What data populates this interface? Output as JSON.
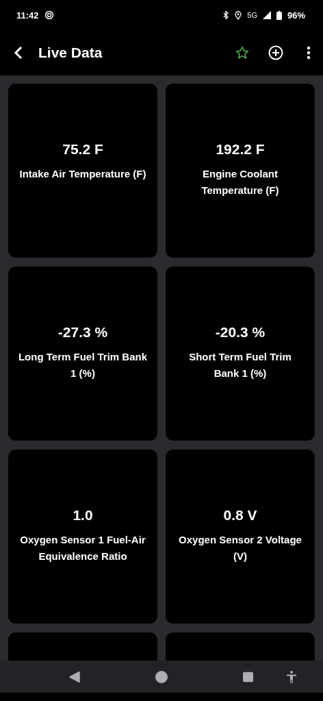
{
  "status_bar": {
    "time": "11:42",
    "network": "5G",
    "battery": "96%"
  },
  "app_bar": {
    "title": "Live Data"
  },
  "tiles": [
    {
      "kind": "reading",
      "value": "75.2 F",
      "label": "Intake Air Temperature (F)"
    },
    {
      "kind": "reading",
      "value": "192.2 F",
      "label": "Engine Coolant Temperature (F)"
    },
    {
      "kind": "reading",
      "value": "-27.3 %",
      "label": "Long Term Fuel Trim Bank 1 (%)"
    },
    {
      "kind": "reading",
      "value": "-20.3 %",
      "label": "Short Term Fuel Trim Bank 1 (%)"
    },
    {
      "kind": "reading",
      "value": "1.0",
      "label": "Oxygen Sensor 1 Fuel-Air Equivalence Ratio"
    },
    {
      "kind": "reading",
      "value": "0.8 V",
      "label": "Oxygen Sensor 2 Voltage (V)"
    },
    {
      "kind": "cut"
    },
    {
      "kind": "cut"
    }
  ]
}
